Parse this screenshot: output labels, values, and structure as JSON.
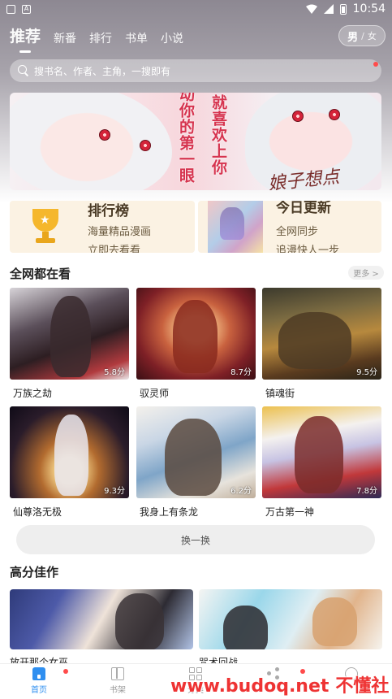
{
  "status_bar": {
    "time": "10:54"
  },
  "top_nav": {
    "tabs": [
      {
        "label": "推荐",
        "active": true
      },
      {
        "label": "新番"
      },
      {
        "label": "排行"
      },
      {
        "label": "书单"
      },
      {
        "label": "小说"
      }
    ],
    "gender": {
      "male": "男",
      "separator": "/",
      "female": "女"
    }
  },
  "search": {
    "placeholder": "搜书名、作者、主角，一搜即有"
  },
  "banner": {
    "vertical_text_1": "就喜欢上你",
    "vertical_text_2": "动你的第一眼",
    "signature": "娘子想点"
  },
  "promos": {
    "rank": {
      "title": "排行榜",
      "line1": "海量精品漫画",
      "line2": "立即去看看"
    },
    "update": {
      "title": "今日更新",
      "line1": "全网同步",
      "line2": "追漫快人一步"
    }
  },
  "section_watching": {
    "title": "全网都在看",
    "more": "更多 >",
    "items": [
      {
        "name": "万族之劫",
        "score": "5.8分"
      },
      {
        "name": "驭灵师",
        "score": "8.7分"
      },
      {
        "name": "镇魂街",
        "score": "9.5分"
      },
      {
        "name": "仙尊洛无极",
        "score": "9.3分"
      },
      {
        "name": "我身上有条龙",
        "score": "6.2分"
      },
      {
        "name": "万古第一神",
        "score": "7.8分"
      }
    ],
    "swap_label": "换一换"
  },
  "section_top": {
    "title": "高分佳作",
    "items": [
      {
        "name": "放开那个女巫"
      },
      {
        "name": "咒术回战"
      }
    ]
  },
  "bottom_nav": {
    "items": [
      {
        "label": "首页",
        "active": true
      },
      {
        "label": "书架"
      },
      {
        "label": "分类"
      },
      {
        "label": ""
      },
      {
        "label": ""
      }
    ]
  },
  "watermark": {
    "url": "www.budoq.net",
    "text": "不懂社区"
  },
  "colors": {
    "accent": "#2f8ff0",
    "badge": "#ff4b4b",
    "promo_bg": "#fbf2e3"
  }
}
